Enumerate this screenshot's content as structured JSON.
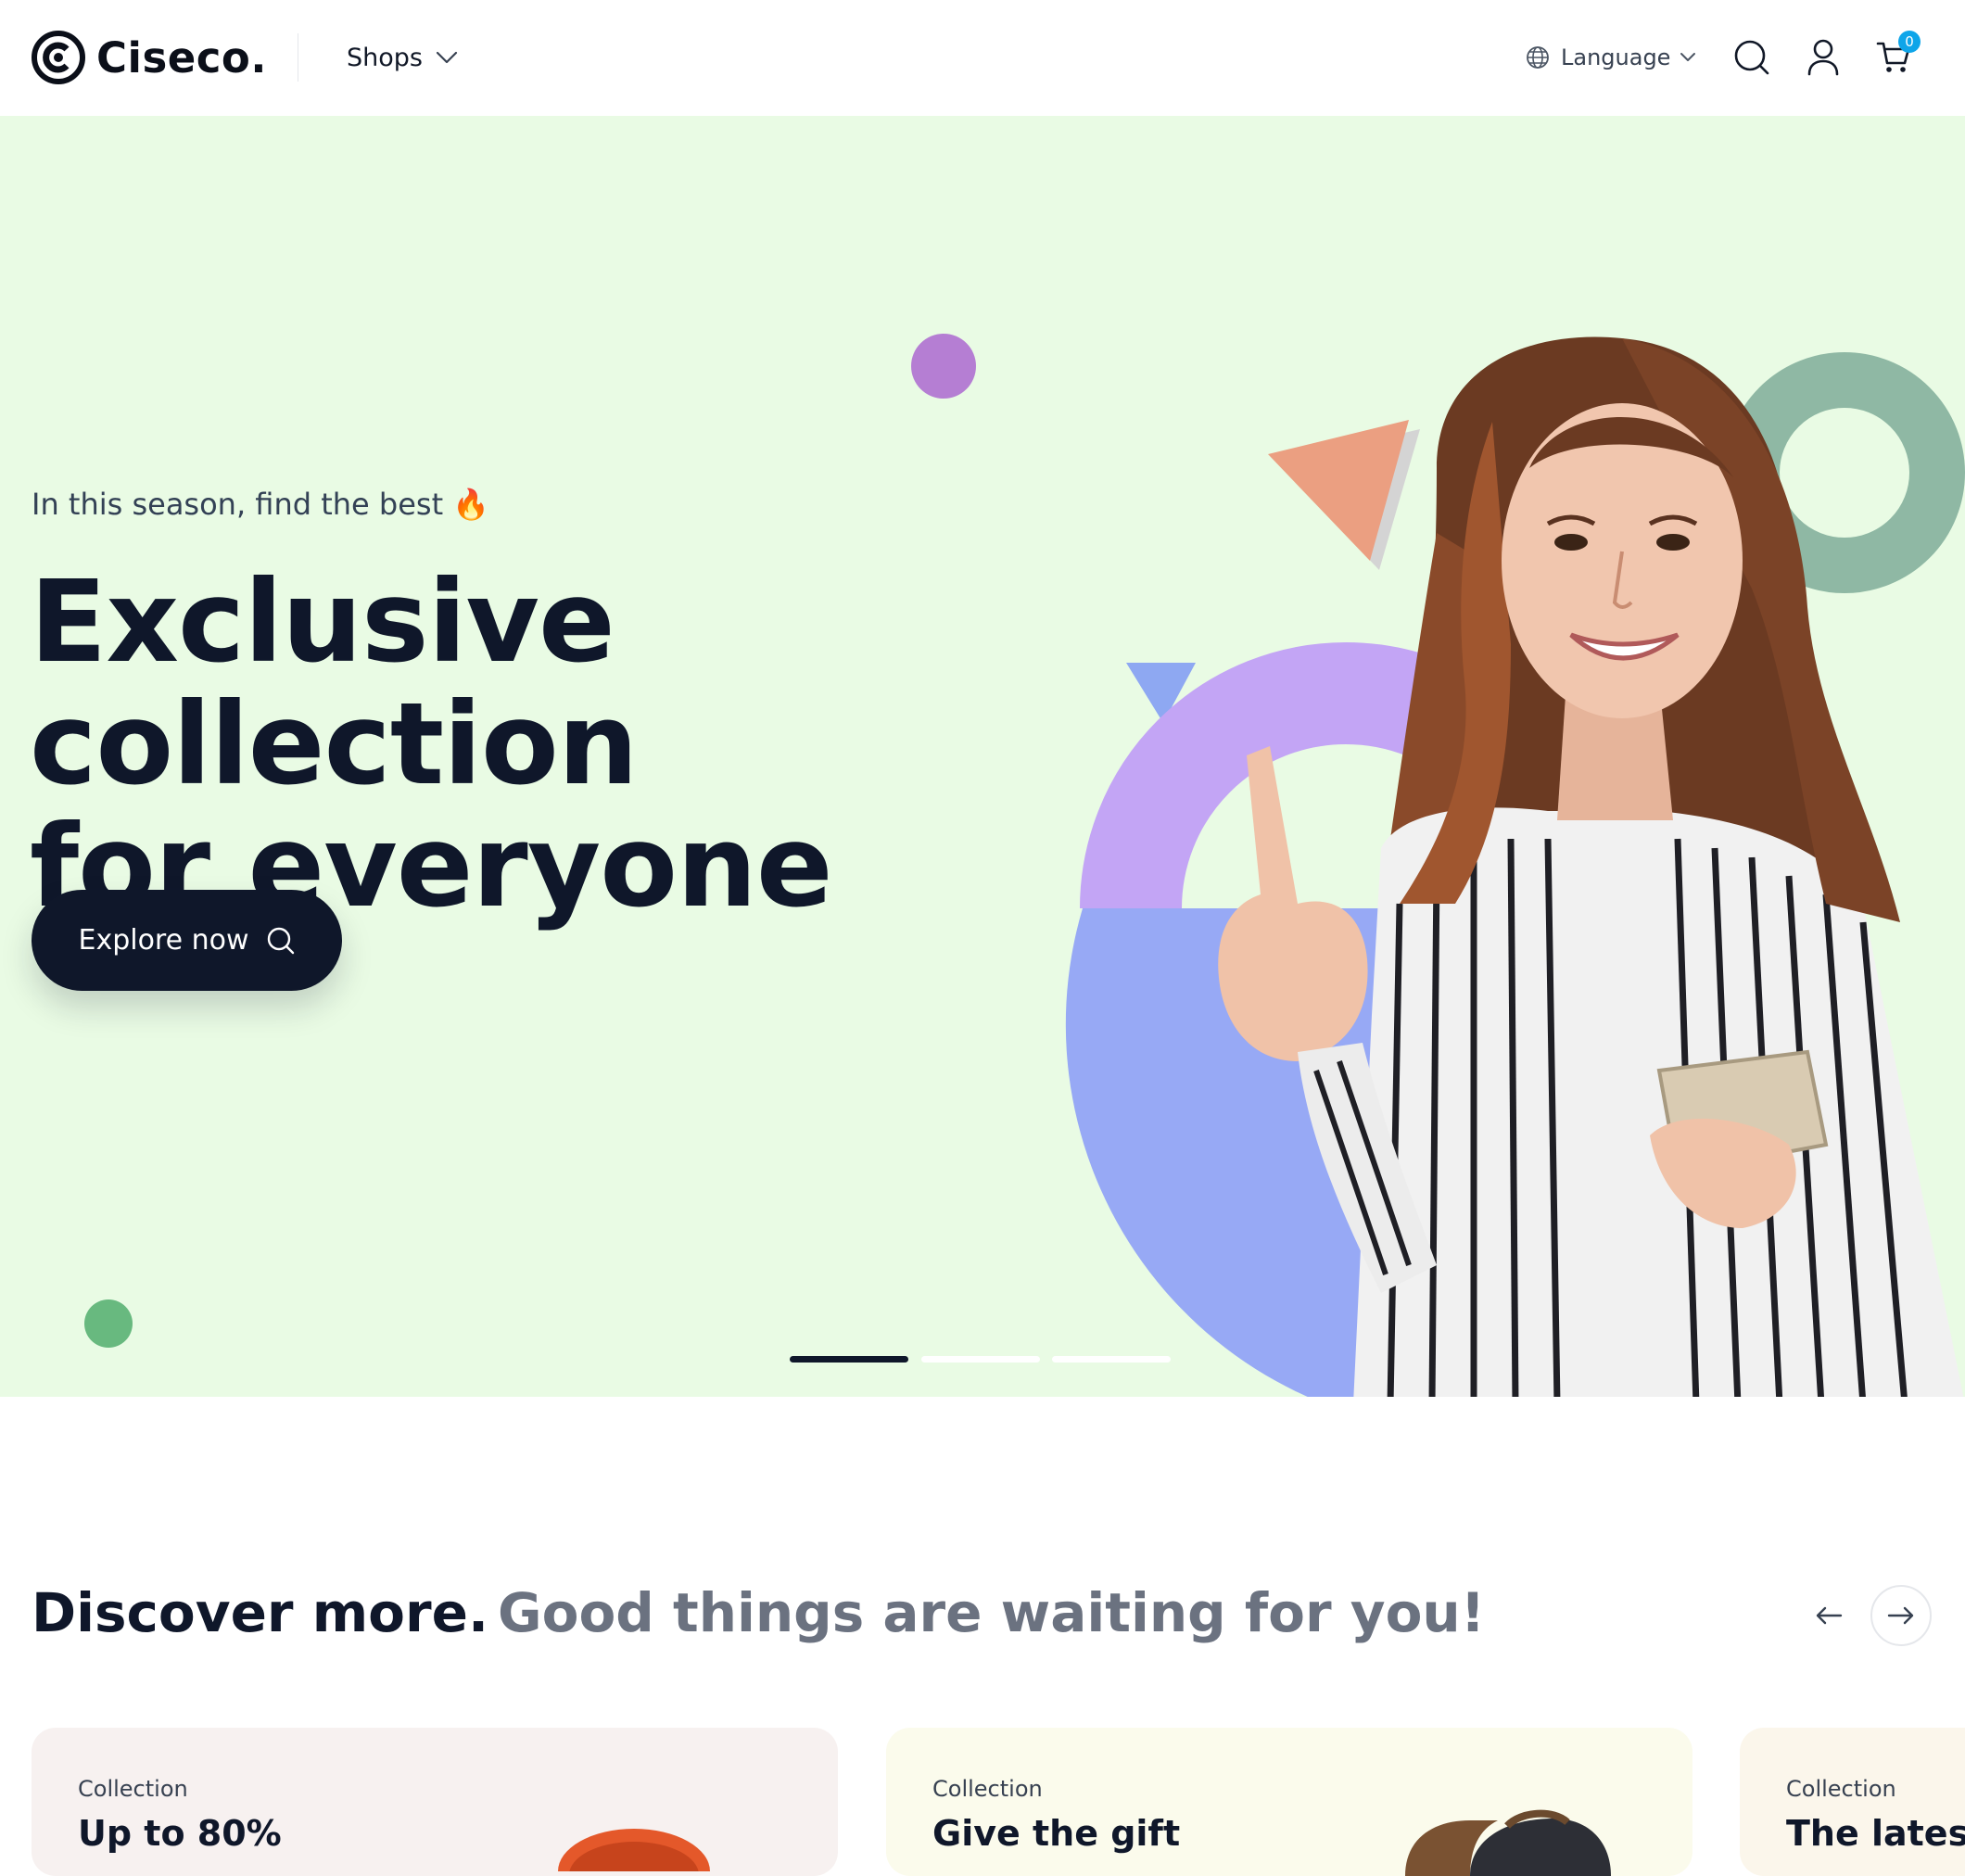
{
  "header": {
    "brand": "Ciseco.",
    "shops_label": "Shops",
    "language_label": "Language",
    "cart_count": "0"
  },
  "hero": {
    "subtitle": "In this season, find the best 🔥",
    "title_line1": "Exclusive collection",
    "title_line2": "for everyone",
    "cta_label": "Explore now",
    "slides_total": 3,
    "active_slide": 1
  },
  "discover": {
    "heading": "Discover more.",
    "subheading": "Good things are waiting for you!"
  },
  "cards": [
    {
      "label": "Collection",
      "title": "Up to 80%"
    },
    {
      "label": "Collection",
      "title": "Give the gift"
    },
    {
      "label": "Collection",
      "title": "The latest"
    }
  ],
  "colors": {
    "hero_bg": "#e9fbe4",
    "dark": "#0f172a",
    "badge": "#0ea5e9"
  }
}
